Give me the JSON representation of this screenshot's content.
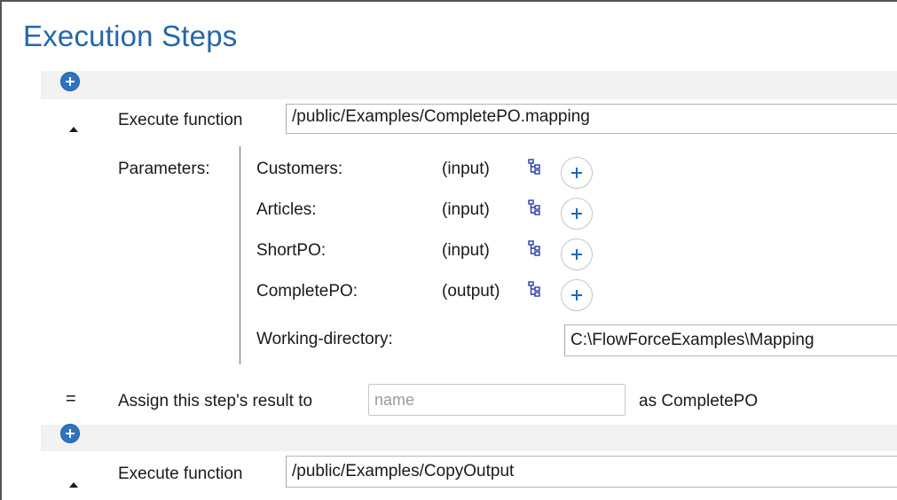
{
  "page": {
    "title": "Execution Steps"
  },
  "steps": [
    {
      "label": "Execute function",
      "function_path": "/public/Examples/CompletePO.mapping",
      "parameters_label": "Parameters:",
      "parameters": [
        {
          "name": "Customers:",
          "direction": "(input)"
        },
        {
          "name": "Articles:",
          "direction": "(input)"
        },
        {
          "name": "ShortPO:",
          "direction": "(input)"
        },
        {
          "name": "CompletePO:",
          "direction": "(output)"
        }
      ],
      "working_directory_label": "Working-directory:",
      "working_directory_value": "C:\\FlowForceExamples\\Mapping",
      "assign_label": "Assign this step's result to",
      "assign_placeholder": "name",
      "assign_suffix": "as CompletePO"
    },
    {
      "label": "Execute function",
      "function_path": "/public/Examples/CopyOutput"
    }
  ],
  "icons": {
    "add": "plus-icon",
    "collapse": "collapse-triangle-icon",
    "tree": "structure-tree-icon",
    "assign": "equals-icon"
  },
  "colors": {
    "title": "#2467a8",
    "accent": "#2f74c0",
    "band": "#f2f2f2"
  }
}
